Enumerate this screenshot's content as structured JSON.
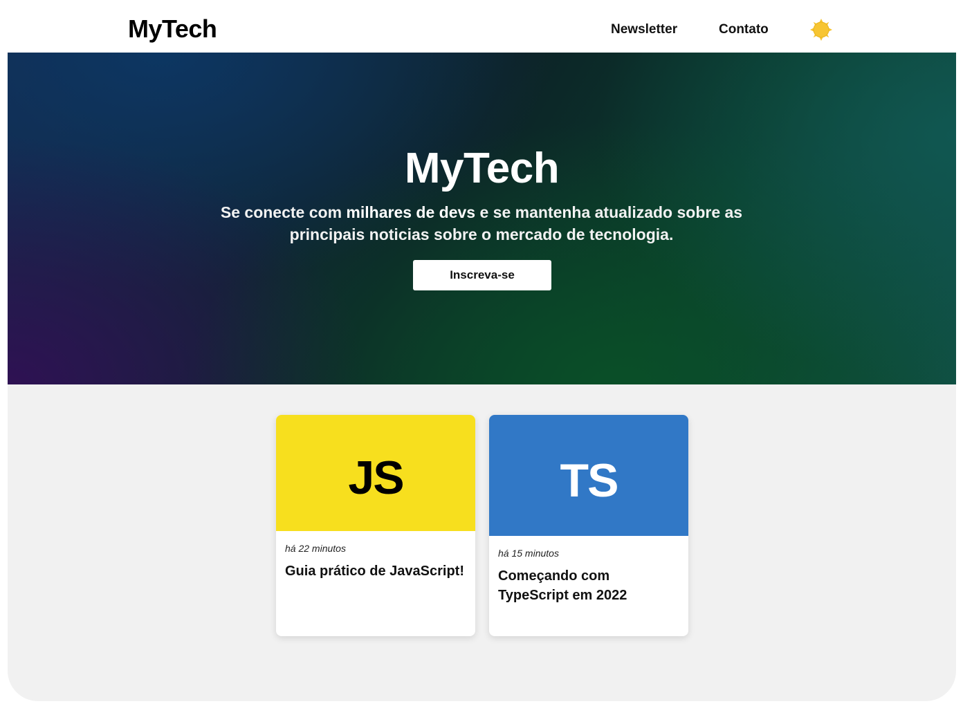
{
  "header": {
    "logo": "MyTech",
    "nav": [
      {
        "label": "Newsletter"
      },
      {
        "label": "Contato"
      }
    ],
    "theme_icon": "sun-icon"
  },
  "hero": {
    "title": "MyTech",
    "subtitle_before": "Se conecte com ",
    "subtitle_bold": "milhares de devs",
    "subtitle_after": " e se mantenha atualizado sobre as principais noticias sobre o mercado de tecnologia.",
    "button_label": "Inscreva-se"
  },
  "cards": [
    {
      "image_text": "JS",
      "image_color": "#f7df1e",
      "time": "há 22 minutos",
      "title": "Guia prático de JavaScript!"
    },
    {
      "image_text": "TS",
      "image_color": "#3178c6",
      "time": "há 15 minutos",
      "title": "Começando com TypeScript em 2022"
    }
  ],
  "colors": {
    "sun": "#f7c531",
    "content_background": "#f1f1f1"
  }
}
